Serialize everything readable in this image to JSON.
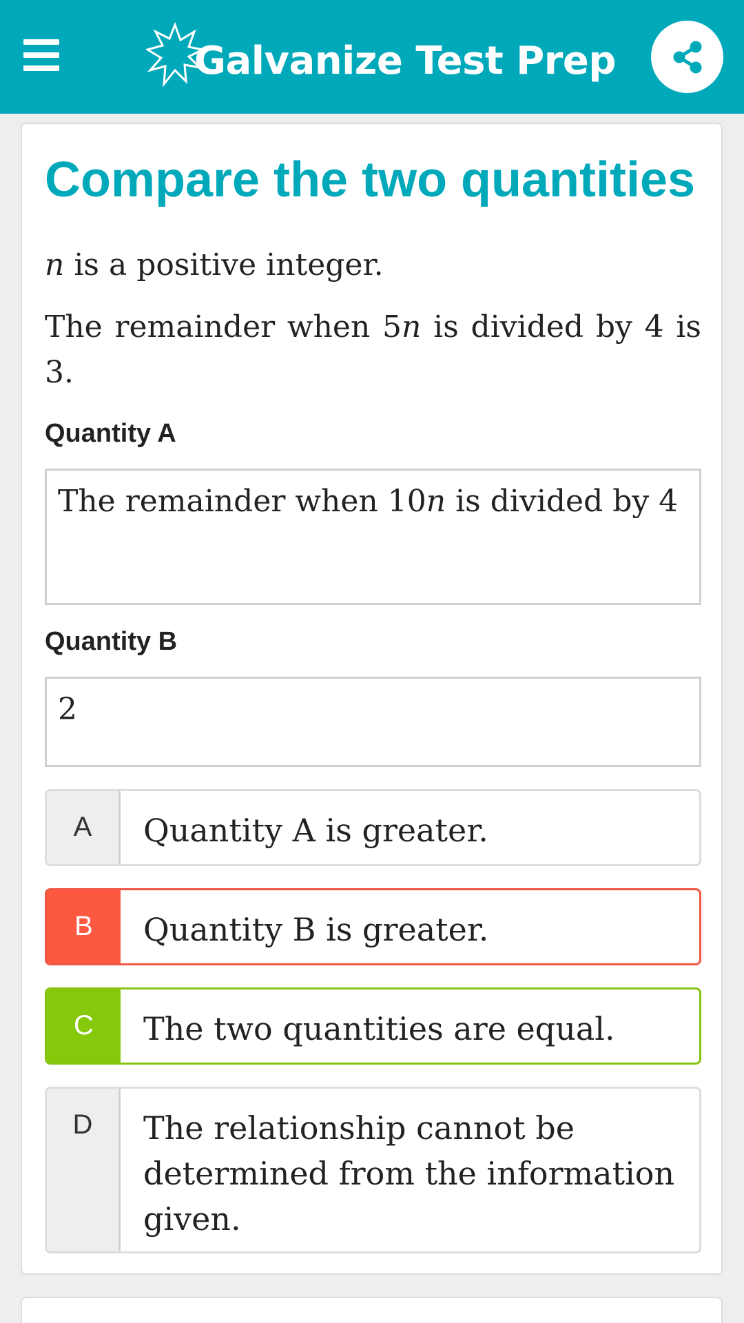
{
  "app_bar": {
    "title": "Galvanize Test Prep",
    "menu_icon": "hamburger-menu-icon",
    "share_icon": "share-icon",
    "background_color": "#00a9ba"
  },
  "question": {
    "heading": "Compare the two quantities",
    "stem_line1_var": "n",
    "stem_line1_text": " is a positive integer.",
    "stem_line2_pre": "The remainder when ",
    "stem_line2_coef": "5",
    "stem_line2_var": "n",
    "stem_line2_post": " is divided by 4 is 3.",
    "quantity_a": {
      "label": "Quantity A",
      "pre": "The remainder when ",
      "coef": "10",
      "var": "n",
      "post": " is divided by 4"
    },
    "quantity_b": {
      "label": "Quantity B",
      "value": "2"
    }
  },
  "options": [
    {
      "letter": "A",
      "text": "Quantity A is greater.",
      "state": "neutral"
    },
    {
      "letter": "B",
      "text": "Quantity B is greater.",
      "state": "wrong",
      "color": "#fd5840"
    },
    {
      "letter": "C",
      "text": "The two quantities are equal.",
      "state": "correct",
      "color": "#85c80c"
    },
    {
      "letter": "D",
      "text": "The relationship cannot be determined from the information given.",
      "state": "neutral"
    }
  ]
}
